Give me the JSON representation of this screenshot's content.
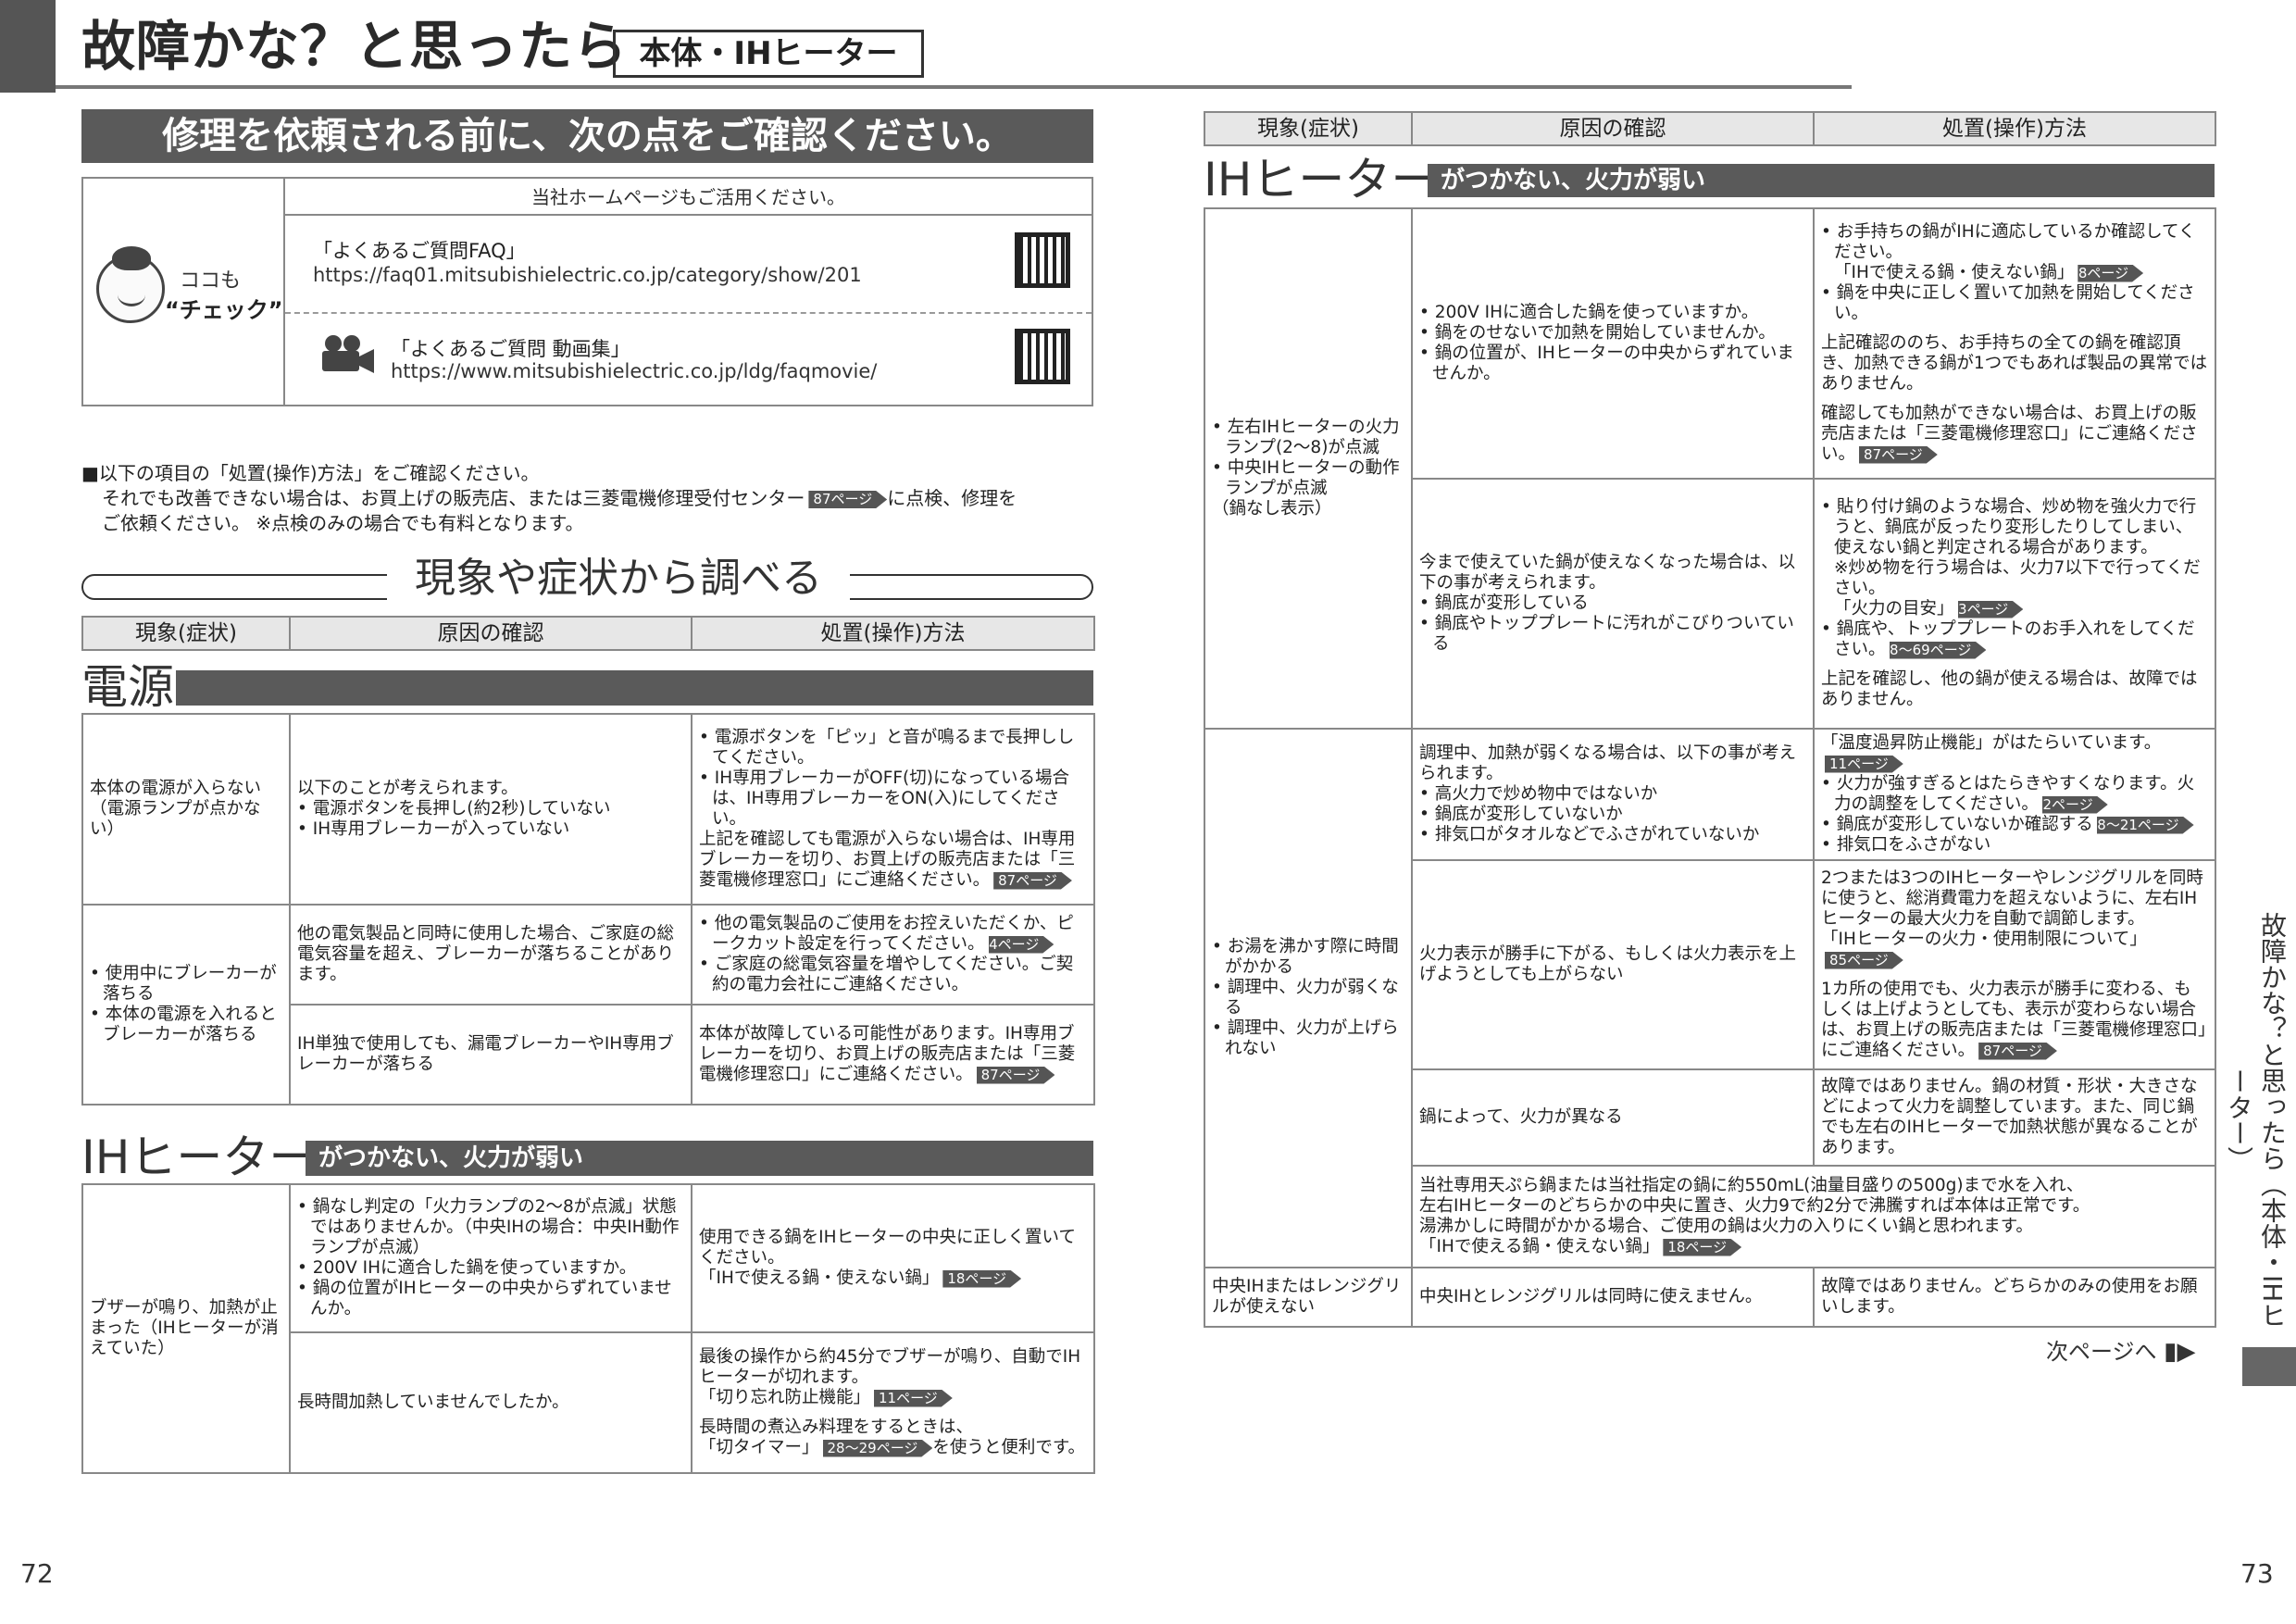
{
  "header": {
    "title": "故障かな？と思ったら",
    "subtitle": "本体・IHヒーター"
  },
  "banner": "修理を依頼される前に、次の点をご確認ください。",
  "homepage": {
    "top": "当社ホームページもご活用ください。",
    "mascot_line1": "ココも",
    "mascot_line2": "“チェック”",
    "faq_title": "「よくあるご質問FAQ」",
    "faq_url": "https://faq01.mitsubishielectric.co.jp/category/show/201",
    "movie_title": "「よくあるご質問 動画集」",
    "movie_url": "https://www.mitsubishielectric.co.jp/ldg/faqmovie/"
  },
  "note": {
    "l1": "■以下の項目の「処置(操作)方法」をご確認ください。",
    "l2a": "それでも改善できない場合は、お買上げの販売店、または三菱電機修理受付センター",
    "l2ref": "87ページ",
    "l2b": "に点検、修理を",
    "l3": "ご依頼ください。 ※点検のみの場合でも有料となります。"
  },
  "section_title": "現象や症状から調べる",
  "cols": {
    "c1": "現象(症状)",
    "c2": "原因の確認",
    "c3": "処置(操作)方法"
  },
  "power": {
    "cat": "電源",
    "r1": {
      "sym": "本体の電源が入らない（電源ランプが点かない）",
      "cause0": "以下のことが考えられます。",
      "cause1": "電源ボタンを長押し(約2秒)していない",
      "cause2": "IH専用ブレーカーが入っていない",
      "a1": "電源ボタンを「ピッ」と音が鳴るまで長押ししてください。",
      "a2": "IH専用ブレーカーがOFF(切)になっている場合は、IH専用ブレーカーをON(入)にしてください。",
      "a3": "上記を確認しても電源が入らない場合は、IH専用ブレーカーを切り、お買上げの販売店または「三菱電機修理窓口」にご連絡ください。",
      "ref": "87ページ"
    },
    "r2": {
      "sym1": "使用中にブレーカーが落ちる",
      "sym2": "本体の電源を入れるとブレーカーが落ちる",
      "cause": "他の電気製品と同時に使用した場合、ご家庭の総電気容量を超え、ブレーカーが落ちることがあります。",
      "a1": "他の電気製品のご使用をお控えいただくか、ピークカット設定を行ってください。",
      "a1ref": "64ページ",
      "a2": "ご家庭の総電気容量を増やしてください。ご契約の電力会社にご連絡ください。"
    },
    "r3": {
      "cause": "IH単独で使用しても、漏電ブレーカーやIH専用ブレーカーが落ちる",
      "a": "本体が故障している可能性があります。IH専用ブレーカーを切り、お買上げの販売店または「三菱電機修理窓口」にご連絡ください。",
      "ref": "87ページ"
    }
  },
  "ih_left": {
    "cat": "IHヒーター",
    "bar": "がつかない、火力が弱い",
    "sym": "ブザーが鳴り、加熱が止まった（IHヒーターが消えていた）",
    "r1": {
      "c1": "鍋なし判定の「火力ランプの2～8が点滅」状態ではありませんか。（中央IHの場合：中央IH動作ランプが点滅）",
      "c2": "200V IHに適合した鍋を使っていますか。",
      "c3": "鍋の位置がIHヒーターの中央からずれていませんか。",
      "a": "使用できる鍋をIHヒーターの中央に正しく置いてください。",
      "a_link": "「IHで使える鍋・使えない鍋」",
      "ref": "18ページ"
    },
    "r2": {
      "cause": "長時間加熱していませんでしたか。",
      "a1": "最後の操作から約45分でブザーが鳴り、自動でIHヒーターが切れます。",
      "a1_link": "「切り忘れ防止機能」",
      "a1ref": "11ページ",
      "a2": "長時間の煮込み料理をするときは、",
      "a2_link": "「切タイマー」",
      "a2ref": "28～29ページ",
      "a2b": "を使うと便利です。"
    }
  },
  "ih_right": {
    "cat": "IHヒーター",
    "bar": "がつかない、火力が弱い",
    "g1": {
      "sym1": "左右IHヒーターの火力ランプ(2～8)が点滅",
      "sym2": "中央IHヒーターの動作ランプが点滅",
      "sym3": "（鍋なし表示）",
      "r1": {
        "c1": "200V IHに適合した鍋を使っていますか。",
        "c2": "鍋をのせないで加熱を開始していませんか。",
        "c3": "鍋の位置が、IHヒーターの中央からずれていませんか。",
        "a1": "お手持ちの鍋がIHに適応しているか確認してください。",
        "a1_link": "「IHで使える鍋・使えない鍋」",
        "a1ref": "18ページ",
        "a2": "鍋を中央に正しく置いて加熱を開始してください。",
        "a3": "上記確認ののち、お手持ちの全ての鍋を確認頂き、加熱できる鍋が1つでもあれば製品の異常ではありません。",
        "a4": "確認しても加熱ができない場合は、お買上げの販売店または「三菱電機修理窓口」にご連絡ください。",
        "a4ref": "87ページ"
      },
      "r2": {
        "c0": "今まで使えていた鍋が使えなくなった場合は、以下の事が考えられます。",
        "c1": "鍋底が変形している",
        "c2": "鍋底やトッププレートに汚れがこびりついている",
        "a1": "貼り付け鍋のような場合、炒め物を強火力で行うと、鍋底が反ったり変形したりしてしまい、使えない鍋と判定される場合があります。",
        "a1n": "※炒め物を行う場合は、火力7以下で行ってください。",
        "a1_link": "「火力の目安」",
        "a1ref": "23ページ",
        "a2": "鍋底や、トッププレートのお手入れをしてください。",
        "a2ref": "68～69ページ",
        "a3": "上記を確認し、他の鍋が使える場合は、故障ではありません。"
      }
    },
    "g2": {
      "sym1": "お湯を沸かす際に時間がかかる",
      "sym2": "調理中、火力が弱くなる",
      "sym3": "調理中、火力が上げられない",
      "r1": {
        "c0": "調理中、加熱が弱くなる場合は、以下の事が考えられます。",
        "c1": "高火力で炒め物中ではないか",
        "c2": "鍋底が変形していないか",
        "c3": "排気口がタオルなどでふさがれていないか",
        "a0": "「温度過昇防止機能」がはたらいています。",
        "a0ref": "11ページ",
        "a1": "火力が強すぎるとはたらきやすくなります。火力の調整をしてください。",
        "a1ref": "22ページ",
        "a2": "鍋底が変形していないか確認する",
        "a2ref": "18～21ページ",
        "a3": "排気口をふさがない"
      },
      "r2": {
        "c": "火力表示が勝手に下がる、もしくは火力表示を上げようとしても上がらない",
        "a1": "2つまたは3つのIHヒーターやレンジグリルを同時に使うと、総消費電力を超えないように、左右IHヒーターの最大火力を自動で調節します。",
        "a1_link": "「IHヒーターの火力・使用制限について」",
        "a1ref": "85ページ",
        "a2": "1カ所の使用でも、火力表示が勝手に変わる、もしくは上げようとしても、表示が変わらない場合は、お買上げの販売店または「三菱電機修理窓口」にご連絡ください。",
        "a2ref": "87ページ"
      },
      "r3": {
        "c": "鍋によって、火力が異なる",
        "a": "故障ではありません。鍋の材質・形状・大きさなどによって火力を調整しています。また、同じ鍋でも左右のIHヒーターで加熱状態が異なることがあります。"
      },
      "r4": {
        "l1": "当社専用天ぷら鍋または当社指定の鍋に約550mL(油量目盛りの500g)まで水を入れ、",
        "l2": "左右IHヒーターのどちらかの中央に置き、火力9で約2分で沸騰すれば本体は正常です。",
        "l3": "湯沸かしに時間がかかる場合、ご使用の鍋は火力の入りにくい鍋と思われます。",
        "link": "「IHで使える鍋・使えない鍋」",
        "ref": "18ページ"
      }
    },
    "g3": {
      "sym": "中央IHまたはレンジグリルが使えない",
      "c": "中央IHとレンジグリルは同時に使えません。",
      "a": "故障ではありません。どちらかのみの使用をお願いします。"
    }
  },
  "next_page": "次ページへ",
  "side_label": "故障かな？と思ったら（本体・IHヒーター）",
  "page_left": "72",
  "page_right": "73"
}
